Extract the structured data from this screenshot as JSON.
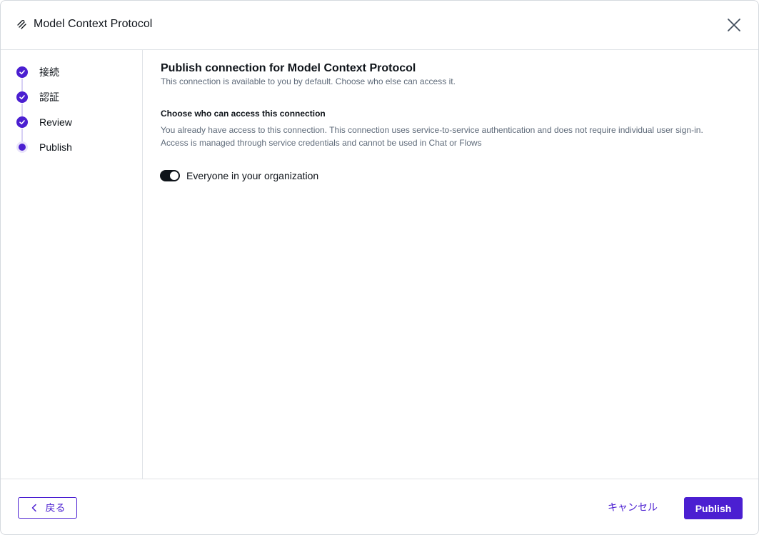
{
  "header": {
    "title": "Model Context Protocol"
  },
  "steps": [
    {
      "label": "接続",
      "status": "done"
    },
    {
      "label": "認証",
      "status": "done"
    },
    {
      "label": "Review",
      "status": "done"
    },
    {
      "label": "Publish",
      "status": "current"
    }
  ],
  "main": {
    "heading": "Publish connection for Model Context Protocol",
    "subtitle": "This connection is available to you by default. Choose who else can access it.",
    "section_title": "Choose who can access this connection",
    "section_desc_line1": "You already have access to this connection. This connection uses service-to-service authentication and does not require individual user sign-in.",
    "section_desc_line2": "Access is managed through service credentials and cannot be used in Chat or Flows",
    "toggle_label": "Everyone in your organization",
    "toggle_on": true
  },
  "footer": {
    "back_label": "戻る",
    "cancel_label": "キャンセル",
    "primary_label": "Publish"
  },
  "colors": {
    "accent": "#4b1fd1",
    "text": "#0f141a",
    "muted": "#5f6b7a"
  }
}
